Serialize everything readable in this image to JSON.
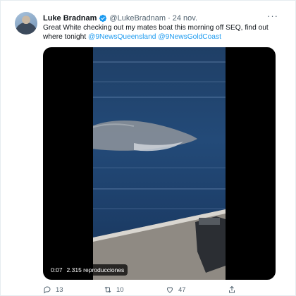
{
  "tweet": {
    "author_name": "Luke Bradnam",
    "handle": "@LukeBradnam",
    "separator": "·",
    "date": "24 nov.",
    "text_main": "Great White checking out my mates boat this morning off SEQ, find out where tonight ",
    "mention1": "@9NewsQueensland",
    "mention2": "@9NewsGoldCoast",
    "more_label": "···"
  },
  "video": {
    "duration": "0:07",
    "views": "2.315 reproducciones"
  },
  "actions": {
    "replies": "13",
    "retweets": "10",
    "likes": "47"
  },
  "colors": {
    "accent": "#1d9bf0",
    "secondary_text": "#536471",
    "retweet_icon": "#536471"
  },
  "icons": {
    "verified": "verified-badge-icon",
    "more": "more-options-icon",
    "reply": "reply-icon",
    "retweet": "retweet-icon",
    "like": "like-icon",
    "share": "share-icon"
  }
}
